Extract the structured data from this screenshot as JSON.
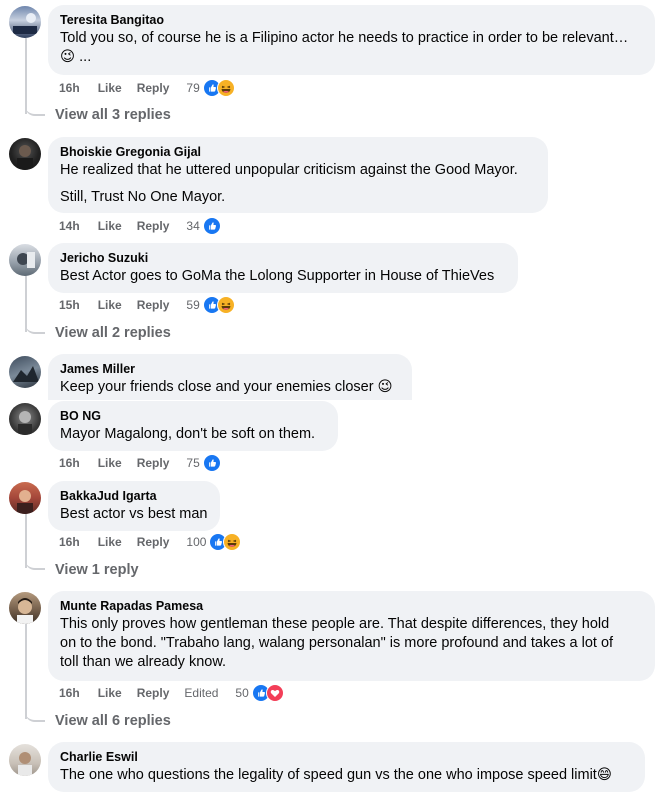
{
  "comments": [
    {
      "name": "Teresita Bangitao",
      "lines": [
        "Told you so, of course he is a Filipino actor he needs to practice in order to be relevant…",
        "😉 ..."
      ],
      "time": "16h",
      "like": "Like",
      "reply": "Reply",
      "count": "79",
      "view_replies": "View all 3 replies"
    },
    {
      "name": "Bhoiskie Gregonia Gijal",
      "lines": [
        "He realized that he uttered unpopular criticism against the Good Mayor.",
        "Still, Trust No One Mayor."
      ],
      "time": "14h",
      "like": "Like",
      "reply": "Reply",
      "count": "34"
    },
    {
      "name": "Jericho Suzuki",
      "lines": [
        "Best Actor goes to GoMa the Lolong Supporter in House of ThieVes"
      ],
      "time": "15h",
      "like": "Like",
      "reply": "Reply",
      "count": "59",
      "view_replies": "View all 2 replies"
    },
    {
      "name": "James Miller",
      "lines": [
        "Keep your friends close and your enemies closer 😉"
      ]
    },
    {
      "name": "BO NG",
      "lines": [
        "Mayor Magalong, don't be soft on them."
      ],
      "time": "16h",
      "like": "Like",
      "reply": "Reply",
      "count": "75"
    },
    {
      "name": "BakkaJud Igarta",
      "lines": [
        "Best actor vs best man"
      ],
      "time": "16h",
      "like": "Like",
      "reply": "Reply",
      "count": "100",
      "view_replies": "View 1 reply"
    },
    {
      "name": "Munte Rapadas Pamesa",
      "lines": [
        "This only proves how gentleman these people are. That despite differences, they hold",
        "on to the bond. \"Trabaho lang, walang personalan\" is more profound and takes a lot of",
        "toll than we already know."
      ],
      "time": "16h",
      "like": "Like",
      "reply": "Reply",
      "edited": "Edited",
      "count": "50",
      "view_replies": "View all 6 replies"
    },
    {
      "name": "Charlie Eswil",
      "lines": [
        "The one who questions the legality of speed gun vs the one who impose speed limit😄"
      ]
    }
  ],
  "colors": {
    "like": "#1877f2",
    "haha": "#f7b125",
    "love": "#f33e58",
    "bubble": "#f0f2f5",
    "meta": "#65676b"
  },
  "icons": {
    "like": "like-icon",
    "haha": "haha-icon",
    "love": "love-icon"
  }
}
